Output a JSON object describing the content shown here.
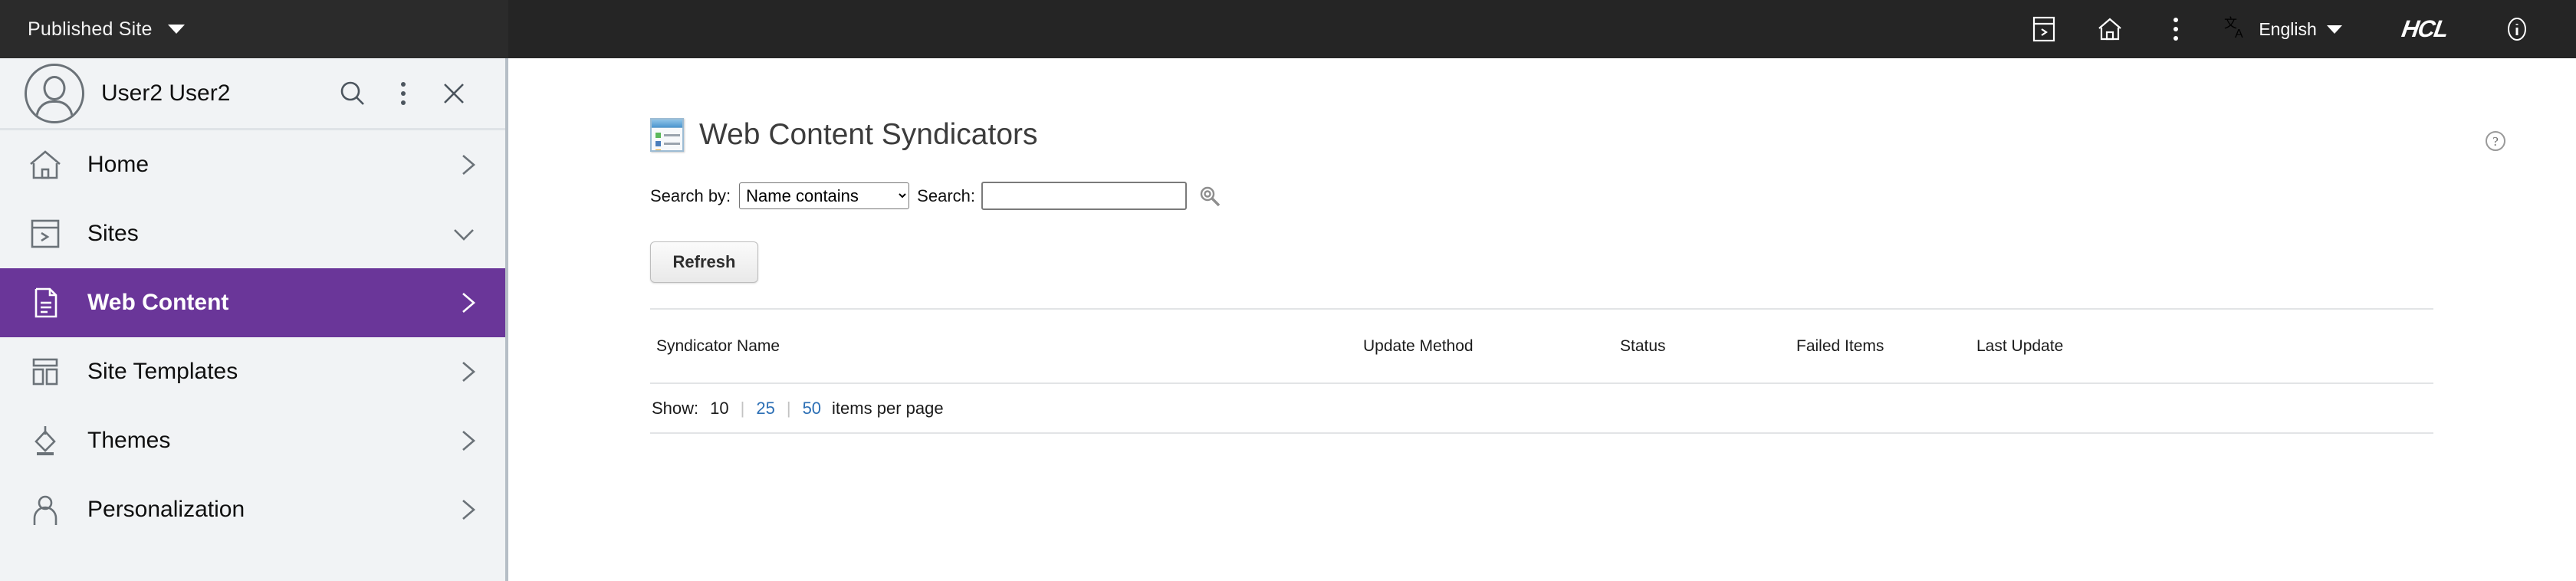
{
  "topbar": {
    "site_selector_label": "Published Site",
    "site_selector_caret": "caret-down-icon",
    "icons": [
      {
        "name": "sites-panel-icon",
        "glyph": "panel"
      },
      {
        "name": "home-icon",
        "glyph": "home"
      },
      {
        "name": "overflow-menu-icon",
        "glyph": "kebab"
      }
    ],
    "language_icon": "translate-icon",
    "language_label": "English",
    "brand_logo": "HCL",
    "info_icon": "info-icon"
  },
  "sidebar": {
    "user": {
      "name": "User2 User2",
      "avatar_icon": "user-avatar-icon",
      "search_icon": "search-icon",
      "overflow_icon": "overflow-menu-icon",
      "close_icon": "close-icon"
    },
    "items": [
      {
        "label": "Home",
        "icon": "home-icon",
        "chevron": "chevron-right-icon",
        "active": false
      },
      {
        "label": "Sites",
        "icon": "sites-panel-icon",
        "chevron": "chevron-down-icon",
        "active": false
      },
      {
        "label": "Web Content",
        "icon": "document-icon",
        "chevron": "chevron-right-icon",
        "active": true
      },
      {
        "label": "Site Templates",
        "icon": "layout-template-icon",
        "chevron": "chevron-right-icon",
        "active": false
      },
      {
        "label": "Themes",
        "icon": "paint-bucket-icon",
        "chevron": "chevron-right-icon",
        "active": false
      },
      {
        "label": "Personalization",
        "icon": "person-icon",
        "chevron": "chevron-right-icon",
        "active": false
      }
    ],
    "active_color": "#6a3699"
  },
  "main": {
    "page_title": "Web Content Syndicators",
    "page_icon": "syndicator-list-icon",
    "help_icon": "?",
    "search": {
      "search_by_label": "Search by:",
      "search_by_value": "Name contains",
      "search_by_options": [
        "Name contains"
      ],
      "search_label": "Search:",
      "search_value": "",
      "search_placeholder": "",
      "search_go_icon": "search-icon"
    },
    "refresh_label": "Refresh",
    "table": {
      "columns": [
        "Syndicator Name",
        "Update Method",
        "Status",
        "Failed Items",
        "Last Update"
      ],
      "rows": []
    },
    "pager": {
      "label": "Show:",
      "options": [
        {
          "value": "10",
          "current": true
        },
        {
          "value": "25",
          "current": false
        },
        {
          "value": "50",
          "current": false
        }
      ],
      "separator": "|",
      "suffix": "items per page",
      "link_color": "#2c6fb5"
    }
  }
}
